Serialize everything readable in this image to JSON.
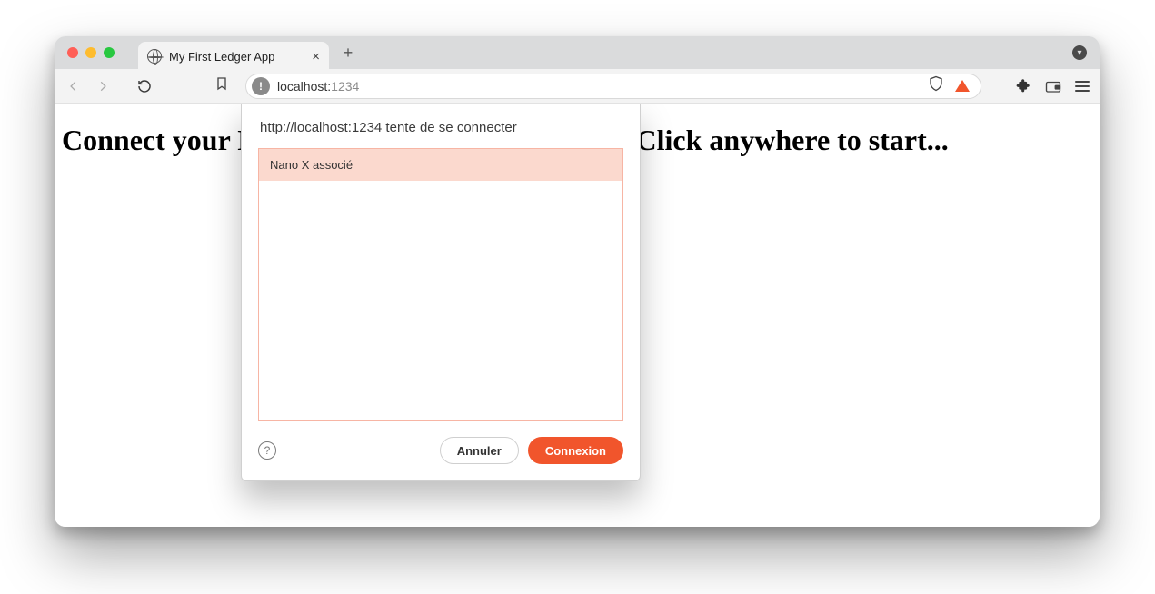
{
  "browser": {
    "tab_title": "My First Ledger App",
    "url_host": "localhost:",
    "url_port": "1234"
  },
  "page": {
    "heading": "Connect your Nano and open the Bitcoin app. Click anywhere to start..."
  },
  "dialog": {
    "title": "http://localhost:1234 tente de se connecter",
    "devices": [
      "Nano X associé"
    ],
    "cancel": "Annuler",
    "submit": "Connexion"
  },
  "colors": {
    "accent": "#f1552c",
    "device_bg": "#fbd9ce",
    "device_border": "#f7b5a4"
  }
}
